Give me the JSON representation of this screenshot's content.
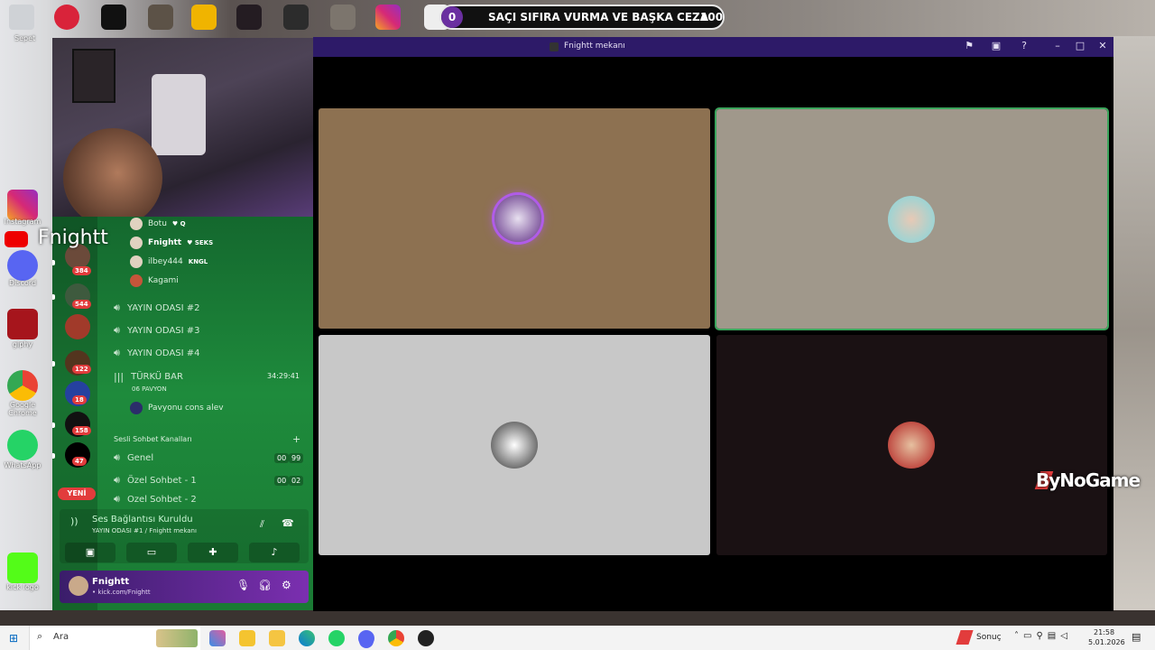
{
  "desktop": {
    "icons": [
      {
        "label": "Instagram"
      },
      {
        "label": "Discord"
      },
      {
        "label": "giphy"
      },
      {
        "label": "Google Chrome"
      },
      {
        "label": "WhatsApp"
      },
      {
        "label": "kick logo"
      }
    ],
    "top_labels": [
      "Sepet"
    ]
  },
  "overlay": {
    "streamer_name": "Fnightt",
    "score_left": "0",
    "score_title": "SAÇI SIFIRA VURMA VE BAŞKA CEZA",
    "score_right": "100",
    "watermark": "ByNoGame"
  },
  "discord": {
    "members": [
      {
        "name": "Botu",
        "tag": "♥ Q"
      },
      {
        "name": "Fnightt",
        "tag": "♥ SEKS"
      },
      {
        "name": "ilbey444",
        "tag": "KNGL"
      },
      {
        "name": "Kagami",
        "tag": ""
      }
    ],
    "channels": [
      {
        "name": "YAYIN ODASI #2"
      },
      {
        "name": "YAYIN ODASI #3"
      },
      {
        "name": "YAYIN ODASI #4"
      }
    ],
    "turku": {
      "name": "TÜRKÜ BAR",
      "sub": "06 PAVYON",
      "timer": "34:29:41",
      "member": "Pavyonu cons alev"
    },
    "category": "Sesli Sohbet Kanalları",
    "voice_channels": [
      {
        "name": "Genel",
        "a": "00",
        "b": "99"
      },
      {
        "name": "Özel Sohbet - 1",
        "a": "00",
        "b": "02"
      },
      {
        "name": "Özel Sohbet - 2",
        "a": "00",
        "b": "03"
      }
    ],
    "server_badges": [
      "384",
      "544",
      "122",
      "18",
      "158",
      "47"
    ],
    "new_badge": "YENİ",
    "voice_panel": {
      "title": "Ses Bağlantısı Kuruldu",
      "subtitle": "YAYIN ODASI #1 / Fnightt mekanı"
    },
    "user": {
      "name": "Fnightt",
      "status": "• kick.com/Fnightt"
    }
  },
  "window": {
    "title": "Fnightt mekanı"
  },
  "tiles": [
    {
      "bg": "#8d7151"
    },
    {
      "bg": "#a0988b"
    },
    {
      "bg": "#c8c8c8"
    },
    {
      "bg": "#1a1113"
    }
  ],
  "taskbar": {
    "search_label": "Ara",
    "tray_text": "Sonuç",
    "time": "21:58",
    "date": "5.01.2026"
  }
}
